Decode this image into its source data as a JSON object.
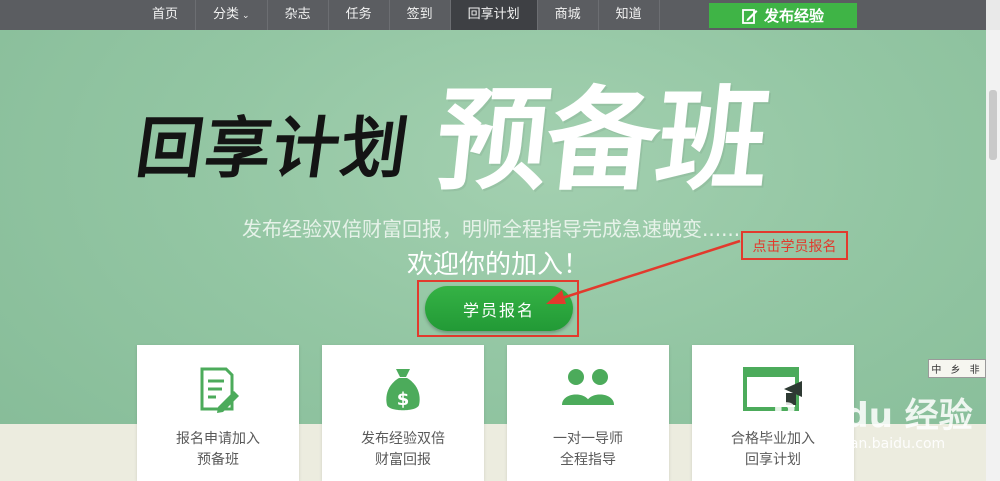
{
  "nav": {
    "items": [
      {
        "label": "首页"
      },
      {
        "label": "分类",
        "has_dropdown": true
      },
      {
        "label": "杂志"
      },
      {
        "label": "任务"
      },
      {
        "label": "签到"
      },
      {
        "label": "回享计划",
        "active": true
      },
      {
        "label": "商城"
      },
      {
        "label": "知道"
      }
    ],
    "publish_label": "发布经验"
  },
  "hero": {
    "title_left": "回享计划",
    "title_right": "预备班",
    "subtitle": "发布经验双倍财富回报，明师全程指导完成急速蜕变......",
    "welcome": "欢迎你的加入！",
    "enroll_label": "学员报名",
    "annotation": "点击学员报名"
  },
  "cards": [
    {
      "icon": "document-edit-icon",
      "line1": "报名申请加入",
      "line2": "预备班"
    },
    {
      "icon": "money-bag-icon",
      "line1": "发布经验双倍",
      "line2": "财富回报"
    },
    {
      "icon": "mentor-users-icon",
      "line1": "一对一导师",
      "line2": "全程指导"
    },
    {
      "icon": "graduation-cap-icon",
      "line1": "合格毕业加入",
      "line2": "回享计划"
    }
  ],
  "badge": "中 乡 非",
  "watermark": {
    "brand": "Bai du 经验",
    "url": "jingyan.baidu.com"
  },
  "colors": {
    "accent_green": "#3fb446",
    "nav_bg": "#5b5d61",
    "annotation_red": "#e23a2d",
    "hero_bg": "#8fc3a0"
  }
}
